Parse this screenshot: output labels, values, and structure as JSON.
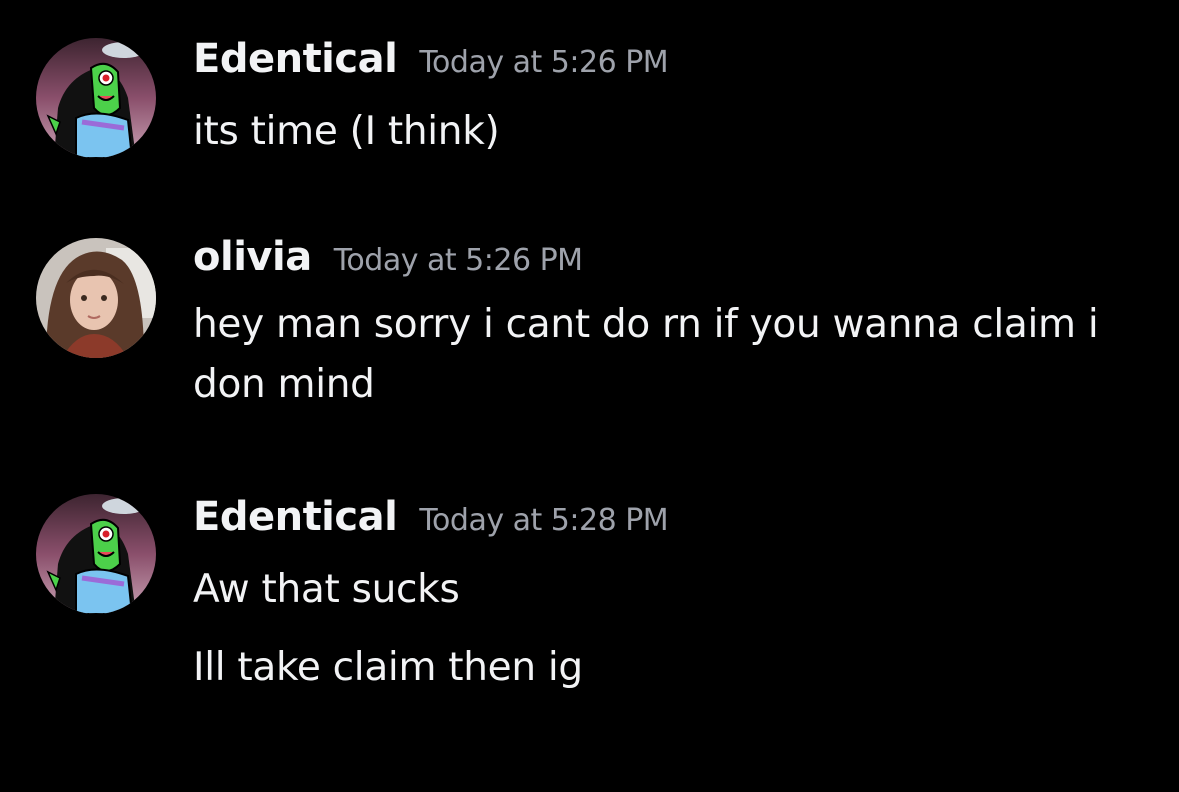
{
  "messages": [
    {
      "username": "Edentical",
      "timestamp": "Today at 5:26 PM",
      "avatar": "alien-character-avatar",
      "lines": [
        "its time (I think)"
      ]
    },
    {
      "username": "olivia",
      "timestamp": "Today at 5:26 PM",
      "avatar": "person-photo-avatar",
      "lines": [
        "hey man sorry i cant do rn if you wanna claim i",
        "don mind"
      ]
    },
    {
      "username": "Edentical",
      "timestamp": "Today at 5:28 PM",
      "avatar": "alien-character-avatar",
      "lines": [
        "Aw that sucks",
        "Ill take claim then ig"
      ]
    }
  ],
  "colors": {
    "background": "#000000",
    "username": "#f2f3f5",
    "timestamp": "#9ea2ab",
    "text": "#f2f3f5"
  }
}
